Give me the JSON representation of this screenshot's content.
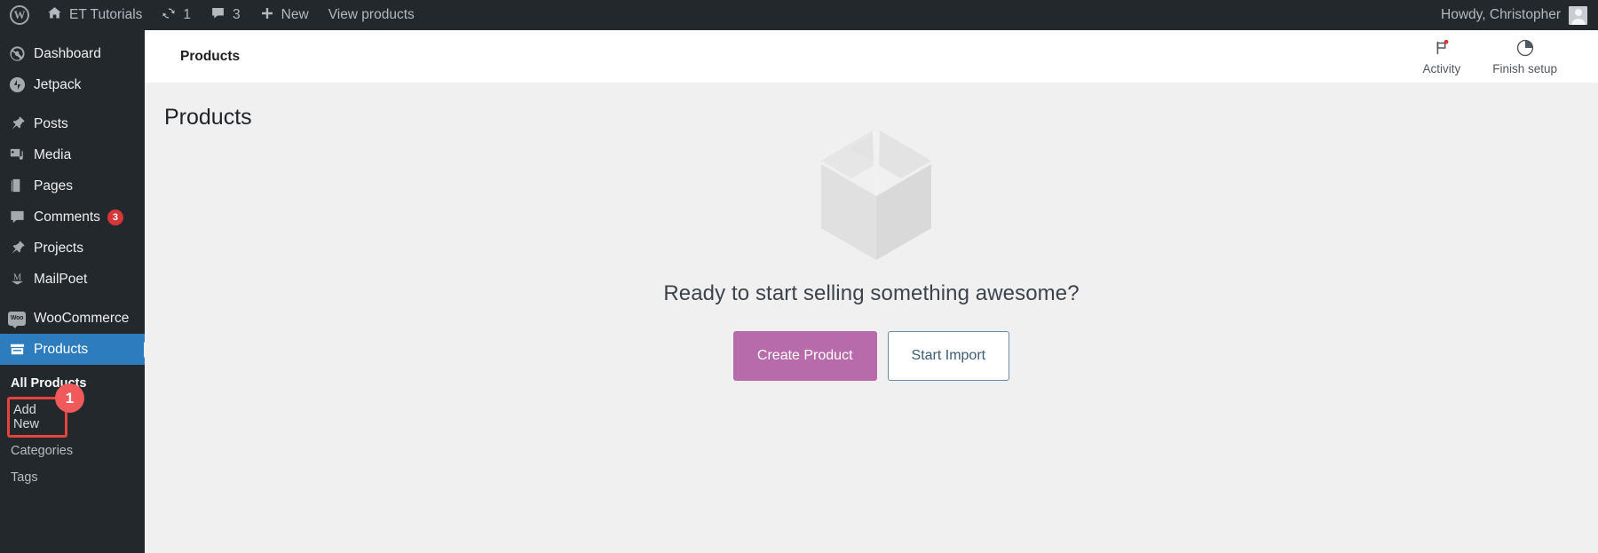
{
  "adminbar": {
    "logo_icon": "wordpress-logo-icon",
    "site_name": "ET Tutorials",
    "site_icon": "home-icon",
    "updates_icon": "updates-icon",
    "updates_count": "1",
    "comments_icon": "comment-bubble-icon",
    "comments_count": "3",
    "new_icon": "plus-icon",
    "new_label": "New",
    "view_products_label": "View products",
    "howdy_label": "Howdy, Christopher",
    "avatar_icon": "user-avatar"
  },
  "sidebar": {
    "items": [
      {
        "label": "Dashboard",
        "icon": "dashboard-icon",
        "active": false
      },
      {
        "label": "Jetpack",
        "icon": "jetpack-icon",
        "active": false
      },
      {
        "label": "Posts",
        "icon": "pin-icon",
        "active": false
      },
      {
        "label": "Media",
        "icon": "media-icon",
        "active": false
      },
      {
        "label": "Pages",
        "icon": "pages-icon",
        "active": false
      },
      {
        "label": "Comments",
        "icon": "comment-icon",
        "badge": "3",
        "active": false
      },
      {
        "label": "Projects",
        "icon": "pin-icon",
        "active": false
      },
      {
        "label": "MailPoet",
        "icon": "mailpoet-icon",
        "active": false
      },
      {
        "label": "WooCommerce",
        "icon": "woocommerce-icon",
        "active": false
      },
      {
        "label": "Products",
        "icon": "products-icon",
        "active": true
      }
    ],
    "submenu": [
      {
        "label": "All Products",
        "current": true,
        "highlighted": false
      },
      {
        "label": "Add New",
        "current": false,
        "highlighted": true
      },
      {
        "label": "Categories",
        "current": false,
        "highlighted": false
      },
      {
        "label": "Tags",
        "current": false,
        "highlighted": false
      }
    ],
    "annotation_badge": "1"
  },
  "woo_header": {
    "breadcrumb": "Products",
    "activity_label": "Activity",
    "activity_icon": "flag-icon",
    "finish_setup_label": "Finish setup",
    "finish_setup_icon": "progress-circle-icon"
  },
  "page": {
    "title": "Products",
    "empty_icon": "package-box-icon",
    "empty_heading": "Ready to start selling something awesome?",
    "primary_button": "Create Product",
    "secondary_button": "Start Import"
  },
  "colors": {
    "adminbar_bg": "#23282d",
    "sidebar_bg": "#23282d",
    "active_menu": "#2d7cbd",
    "accent_purple": "#b76bab",
    "annotation_red": "#f05a5a",
    "highlight_border": "#e8423f",
    "badge_red": "#d63638"
  }
}
